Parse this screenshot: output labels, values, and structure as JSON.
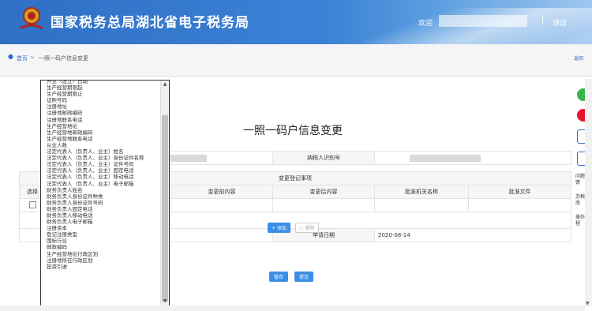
{
  "header": {
    "title": "国家税务总局湖北省电子税务局",
    "welcome": "欢迎",
    "separator": "|",
    "logout": "退出"
  },
  "breadcrumb": {
    "home": "首页",
    "arrow": ">",
    "current": "一照一码户信息变更",
    "back": "返回"
  },
  "page_title": "一照一码户信息变更",
  "form": {
    "taxpayer_id_label": "纳税人识别号",
    "section_label": "变更登记事项",
    "col_select": "选择",
    "col_before": "变更前内容",
    "col_after": "变更后内容",
    "col_authority": "批准机关名称",
    "col_doc": "批准文件",
    "add_button": "添加",
    "delete_button": "删除",
    "apply_date_label": "申请日期",
    "apply_date_value": "2020-08-14",
    "save_button": "暂存",
    "submit_button": "提交"
  },
  "dropdown": {
    "items": [
      "开业（设立）日期",
      "生产经营期限起",
      "生产经营期限止",
      "证照号码",
      "注册地址",
      "注册地邮政编码",
      "注册地联系电话",
      "生产经营地址",
      "生产经营地邮政编码",
      "生产经营地联系电话",
      "从业人数",
      "法定代表人（负责人、业主）姓名",
      "法定代表人（负责人、业主）身份证件名称",
      "法定代表人（负责人、业主）证件号码",
      "法定代表人（负责人、业主）固定电话",
      "法定代表人（负责人、业主）移动电话",
      "法定代表人（负责人、业主）电子邮箱",
      "财务负责人姓名",
      "财务负责人身份证件种类",
      "财务负责人身份证件号码",
      "财务负责人固定电话",
      "财务负责人移动电话",
      "财务负责人电子邮箱",
      "注册资本",
      "登记注册类型",
      "国标行业",
      "邮政编码",
      "生产经营地址行政区划",
      "注册地所在行政区划",
      "投资引进"
    ]
  },
  "sidebar": {
    "items": [
      {
        "label": "",
        "icon": "wechat-icon"
      },
      {
        "label": "",
        "icon": "weibo-icon"
      },
      {
        "label": "",
        "icon": "print-icon"
      },
      {
        "label": "",
        "icon": "print-icon"
      },
      {
        "label": "问题反馈",
        "icon": ""
      },
      {
        "label": "办税指南",
        "icon": ""
      },
      {
        "label": "操作规程",
        "icon": ""
      }
    ]
  },
  "colors": {
    "header_blue": "#2f6fc4",
    "button_blue": "#3a8ee6",
    "wechat_green": "#3ab54a",
    "weibo_red": "#e6162d"
  }
}
